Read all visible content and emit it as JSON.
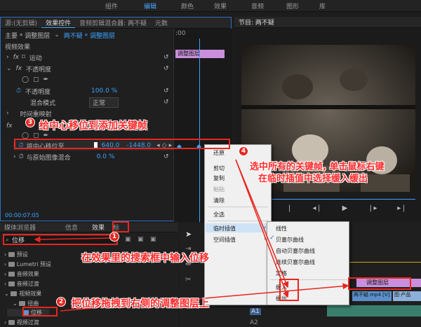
{
  "workspace_tabs": [
    "组件",
    "编辑",
    "颜色",
    "效果",
    "音频",
    "图形",
    "库"
  ],
  "active_workspace": "编辑",
  "effect_controls": {
    "tabs": [
      "源:(无剪辑)",
      "效果控件",
      "音频剪辑混合器: 两不疑",
      "元数"
    ],
    "clip_path_main": "主要 * 调整图层",
    "clip_path_seq": "两不疑 * 调整图层",
    "timeline_label": "调整图层",
    "section": "视频效果",
    "motion": "运动",
    "opacity": "不透明度",
    "opacity_field": "不透明度",
    "opacity_value": "100.0 %",
    "blend_label": "混合模式",
    "blend_value": "正常",
    "time_remap": "时间重映射",
    "transform_label": "将中心移位至",
    "transform_x": "640.0",
    "transform_y": "-1448.0",
    "blend_original": "与原始图像混合",
    "blend_original_value": "0.0 %",
    "timecode": "00:00:07:05"
  },
  "program_monitor": {
    "title": "节目: 两不疑"
  },
  "context_menu": {
    "items": [
      "还原",
      "剪切",
      "复制",
      "粘贴",
      "清除",
      "全选",
      "临时插值",
      "空间插值"
    ],
    "disabled": [
      "粘贴"
    ],
    "highlight": "临时插值"
  },
  "sub_menu": {
    "items": [
      "线性",
      "贝塞尔曲线",
      "自动贝塞尔曲线",
      "连续贝塞尔曲线",
      "定格",
      "缓入",
      "缓出"
    ],
    "checked": "贝塞尔曲线"
  },
  "effects_panel": {
    "tabs": [
      "媒体浏览器",
      "信息",
      "效果",
      "标"
    ],
    "active_tab": "效果",
    "search_value": "位移",
    "tree": [
      "预设",
      "Lumetri 预设",
      "音频效果",
      "音频过渡",
      "视频效果",
      "扭曲",
      "位移",
      "视频过渡"
    ]
  },
  "timeline": {
    "tracks": [
      "V3",
      "V2",
      "V1",
      "A1",
      "A2"
    ],
    "clip_adjust": "调整图层",
    "clip_video": "两不疑.mp4 [V]",
    "clip_extra": "图·产品"
  },
  "annotations": {
    "step1": "在效果里的搜索框中输入位移",
    "step2": "把位移拖拽到右侧的调整图层上",
    "step3": "给中心移位到添加关键帧",
    "step4_line1": "选中所有的关键帧, 单击鼠标右键",
    "step4_line2": "在临时插值中选择缓入缓出",
    "n1": "1",
    "n2": "2",
    "n3": "3",
    "n4": "4"
  },
  "colors": {
    "accent": "#4aa3ff",
    "annotation_red": "#e8261f",
    "clip_purple": "#c98fdc"
  }
}
